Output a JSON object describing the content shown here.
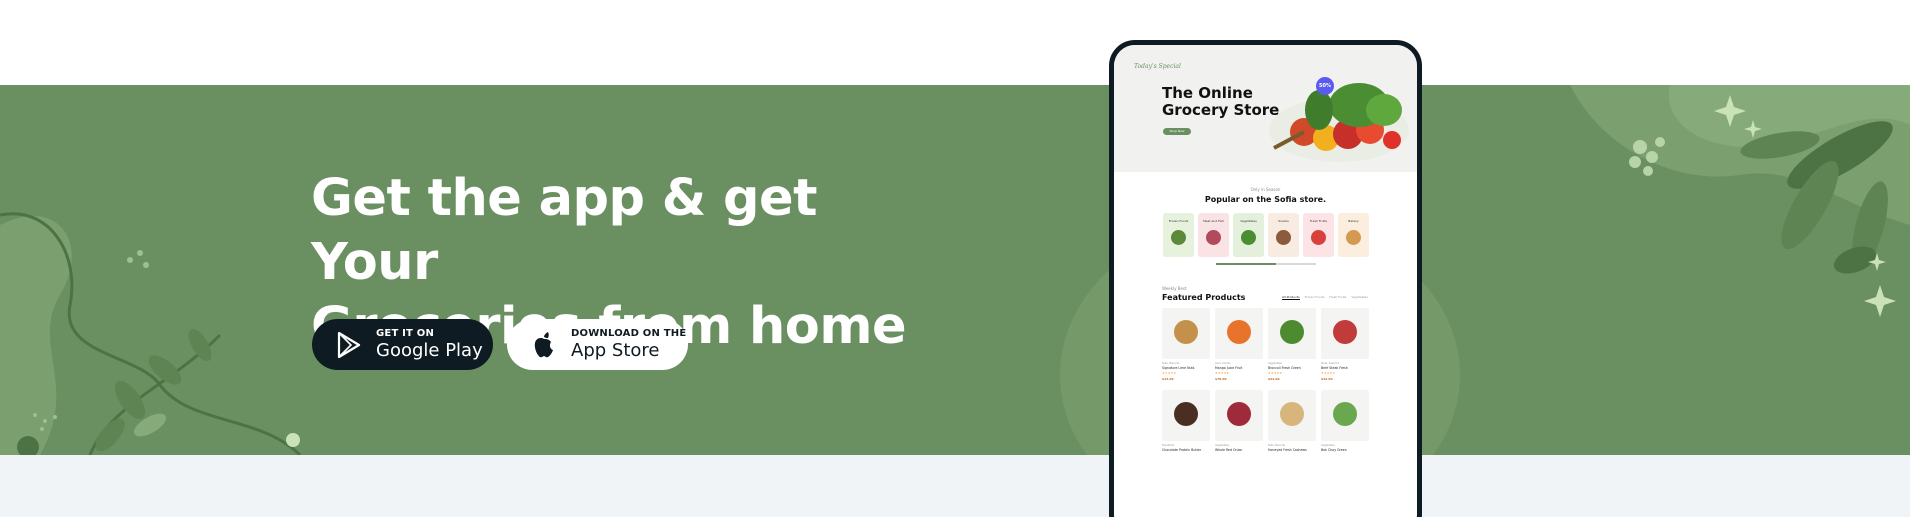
{
  "banner": {
    "headline_line1": "Get the app & get Your",
    "headline_line2": "Groceries from home",
    "background_color": "#6a8f60"
  },
  "google_play": {
    "small": "GET IT ON",
    "big": "Google Play",
    "icon": "google-play-icon"
  },
  "app_store": {
    "small": "DOWNLOAD ON THE",
    "big": "App Store",
    "icon": "apple-icon"
  },
  "phone": {
    "hero_script": "Today's Special",
    "hero_title_1": "The Online",
    "hero_title_2": "Grocery Store",
    "hero_button": "Shop Now",
    "hero_badge": "50%",
    "section1_sub": "Only in Season",
    "section1_title": "Popular on the Sofia store.",
    "categories": [
      {
        "label": "Frozen Foods",
        "bg": "#e7f2de",
        "dot": "#5d8a3a"
      },
      {
        "label": "Meat and Fish",
        "bg": "#f9e3e5",
        "dot": "#b24a5e"
      },
      {
        "label": "Vegetables",
        "bg": "#e4f0dc",
        "dot": "#4b8d33"
      },
      {
        "label": "Snacks",
        "bg": "#f7ebe2",
        "dot": "#8c5a3c"
      },
      {
        "label": "Fresh Fruits",
        "bg": "#fbe3e6",
        "dot": "#d8413b"
      },
      {
        "label": "Bakery",
        "bg": "#fbeede",
        "dot": "#d49a52"
      }
    ],
    "section2_sub": "Weekly Best",
    "section2_title": "Featured Products",
    "tabs": [
      "All Products",
      "Frozen Foods",
      "Fresh Fruits",
      "Vegetables"
    ],
    "products": [
      {
        "cat": "Nuts, Biscuits",
        "name": "Signature Lime Nuts",
        "price": "$14.00",
        "color": "#c4914b"
      },
      {
        "cat": "Juice, Drinks",
        "name": "Mango Juice Fruit",
        "price": "$78.00",
        "color": "#e8742c"
      },
      {
        "cat": "Vegetables",
        "name": "Broccoli Fresh Green",
        "price": "$24.00",
        "color": "#4e8a2f"
      },
      {
        "cat": "Meat, Seafood",
        "name": "Beef Steak Fresh",
        "price": "$42.00",
        "color": "#c23b3b"
      },
      {
        "cat": "Breakfast",
        "name": "Chocolate Protein Butter",
        "price": "",
        "color": "#4a2e22"
      },
      {
        "cat": "Vegetables",
        "name": "Whole Red Onion",
        "price": "",
        "color": "#9e2a3a"
      },
      {
        "cat": "Nuts, Biscuits",
        "name": "Honeyed Fresh Cashews",
        "price": "",
        "color": "#d8b57c"
      },
      {
        "cat": "Vegetables",
        "name": "Bok Choy Green",
        "price": "",
        "color": "#6aa84f"
      }
    ]
  },
  "colors": {
    "dark": "#0f1b23",
    "band": "#6a8f60",
    "footer": "#f1f4f7",
    "leaf_light": "#86aa79",
    "leaf_dark": "#4d7345"
  }
}
